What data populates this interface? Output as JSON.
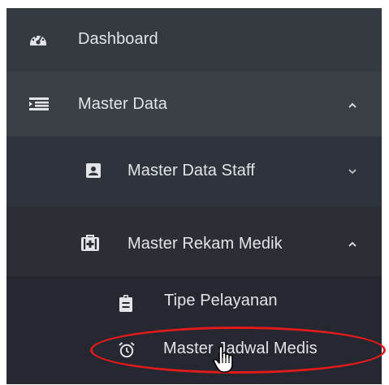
{
  "sidebar": {
    "items": [
      {
        "label": "Dashboard",
        "icon": "dashboard-icon"
      },
      {
        "label": "Master Data",
        "icon": "list-icon",
        "expanded": true
      },
      {
        "label": "Master Data Staff",
        "icon": "id-card-icon",
        "expanded": false
      },
      {
        "label": "Master Rekam Medik",
        "icon": "medkit-icon",
        "expanded": true
      },
      {
        "label": "Tipe Pelayanan",
        "icon": "clipboard-icon"
      },
      {
        "label": "Master Jadwal Medis",
        "icon": "alarm-clock-icon",
        "highlighted": true
      }
    ]
  },
  "colors": {
    "sidebar_bg": "#2c2f37",
    "text": "#e2e4e8",
    "highlight": "#e01b1b"
  }
}
